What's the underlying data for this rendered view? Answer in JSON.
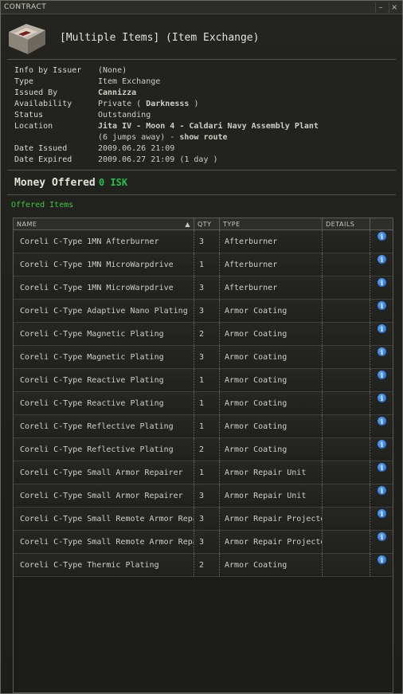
{
  "window": {
    "title": "CONTRACT",
    "minimize_glyph": "–",
    "close_glyph": "×"
  },
  "header": {
    "title": "[Multiple Items] (Item Exchange)",
    "icon": "contract-crate-icon"
  },
  "info": {
    "info_by_issuer": {
      "label": "Info by Issuer",
      "value": "(None)"
    },
    "type": {
      "label": "Type",
      "value": "Item Exchange"
    },
    "issued_by": {
      "label": "Issued By",
      "value": "Cannizza"
    },
    "availability": {
      "label": "Availability",
      "prefix": "Private (",
      "value": "Darknesss",
      "suffix": ")"
    },
    "status": {
      "label": "Status",
      "value": "Outstanding"
    },
    "location": {
      "label": "Location",
      "value": "Jita IV - Moon 4 - Caldari Navy Assembly Plant",
      "jumps": "(6 jumps away) -",
      "route_link": "show route"
    },
    "date_issued": {
      "label": "Date Issued",
      "value": "2009.06.26 21:09"
    },
    "date_expired": {
      "label": "Date Expired",
      "value": "2009.06.27 21:09 (1 day )"
    }
  },
  "money": {
    "label": "Money Offered",
    "value": "0 ISK"
  },
  "offered": {
    "label": "Offered Items",
    "columns": {
      "name": "NAME",
      "qty": "QTY",
      "type": "TYPE",
      "details": "DETAILS"
    },
    "rows": [
      {
        "name": "Coreli C-Type 1MN Afterburner",
        "qty": "3",
        "type": "Afterburner"
      },
      {
        "name": "Coreli C-Type 1MN MicroWarpdrive",
        "qty": "1",
        "type": "Afterburner"
      },
      {
        "name": "Coreli C-Type 1MN MicroWarpdrive",
        "qty": "3",
        "type": "Afterburner"
      },
      {
        "name": "Coreli C-Type Adaptive Nano Plating",
        "qty": "3",
        "type": "Armor Coating"
      },
      {
        "name": "Coreli C-Type Magnetic Plating",
        "qty": "2",
        "type": "Armor Coating"
      },
      {
        "name": "Coreli C-Type Magnetic Plating",
        "qty": "3",
        "type": "Armor Coating"
      },
      {
        "name": "Coreli C-Type Reactive Plating",
        "qty": "1",
        "type": "Armor Coating"
      },
      {
        "name": "Coreli C-Type Reactive Plating",
        "qty": "1",
        "type": "Armor Coating"
      },
      {
        "name": "Coreli C-Type Reflective Plating",
        "qty": "1",
        "type": "Armor Coating"
      },
      {
        "name": "Coreli C-Type Reflective Plating",
        "qty": "2",
        "type": "Armor Coating"
      },
      {
        "name": "Coreli C-Type Small Armor Repairer",
        "qty": "1",
        "type": "Armor Repair Unit"
      },
      {
        "name": "Coreli C-Type Small Armor Repairer",
        "qty": "3",
        "type": "Armor Repair Unit"
      },
      {
        "name": "Coreli C-Type Small Remote Armor Repair",
        "qty": "3",
        "type": "Armor Repair Projector"
      },
      {
        "name": "Coreli C-Type Small Remote Armor Repair",
        "qty": "3",
        "type": "Armor Repair Projector"
      },
      {
        "name": "Coreli C-Type Thermic Plating",
        "qty": "2",
        "type": "Armor Coating"
      }
    ]
  },
  "colors": {
    "highlight": "#f2a03a",
    "money": "#22c24a",
    "section_label": "#3ec83e",
    "info_icon": "#2f7fe6"
  }
}
